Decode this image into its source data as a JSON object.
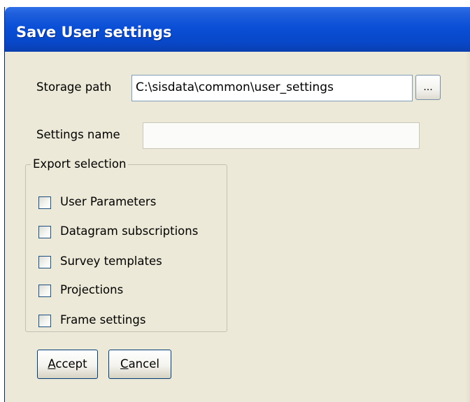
{
  "window": {
    "title": "Save User settings"
  },
  "storage": {
    "label": "Storage path",
    "value": "C:\\sisdata\\common\\user_settings",
    "browse_label": "..."
  },
  "settings_name": {
    "label": "Settings name",
    "value": ""
  },
  "export_selection": {
    "legend": "Export selection",
    "items": [
      {
        "label": "User Parameters",
        "checked": false
      },
      {
        "label": "Datagram subscriptions",
        "checked": false
      },
      {
        "label": "Survey templates",
        "checked": false
      },
      {
        "label": "Projections",
        "checked": false
      },
      {
        "label": "Frame settings",
        "checked": false
      }
    ]
  },
  "buttons": {
    "accept_first": "A",
    "accept_rest": "ccept",
    "cancel_first": "C",
    "cancel_rest": "ancel"
  },
  "colors": {
    "titlebar": "#0a4fd6",
    "dialog_bg": "#ece9d8",
    "title_text": "#ffffff"
  }
}
